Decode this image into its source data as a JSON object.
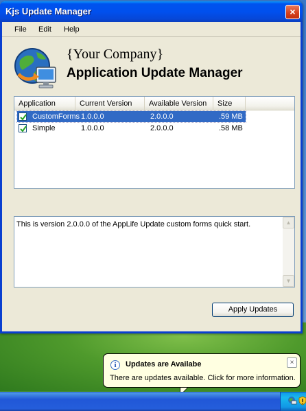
{
  "window": {
    "title": "Kjs Update Manager",
    "close_glyph": "×"
  },
  "menu": {
    "items": [
      "File",
      "Edit",
      "Help"
    ]
  },
  "header": {
    "company": "{Your Company}",
    "title": "Application Update Manager"
  },
  "updates_list": {
    "columns": [
      "Application",
      "Current Version",
      "Available Version",
      "Size"
    ],
    "rows": [
      {
        "checked": true,
        "selected": true,
        "application": "CustomForms",
        "current_version": "1.0.0.0",
        "available_version": "2.0.0.0",
        "size": ".59 MB"
      },
      {
        "checked": true,
        "selected": false,
        "application": "Simple",
        "current_version": "1.0.0.0",
        "available_version": "2.0.0.0",
        "size": ".58 MB"
      }
    ]
  },
  "description": {
    "text": "This is version 2.0.0.0 of the AppLife Update custom forms quick start."
  },
  "buttons": {
    "apply": "Apply Updates"
  },
  "notification": {
    "title": "Updates are Availabe",
    "text": "There are updates available. Click for more information.",
    "close_glyph": "×",
    "info_glyph": "i"
  },
  "colors": {
    "titlebar": "#0050ee",
    "selection": "#316ac5",
    "window_bg": "#ece9d8",
    "balloon_bg": "#ffffe1"
  },
  "icons": [
    "globe-computer-logo-icon",
    "checkbox-icon",
    "info-icon",
    "close-icon",
    "scroll-up-icon",
    "scroll-down-icon",
    "tray-update-icon",
    "tray-shield-icon"
  ]
}
